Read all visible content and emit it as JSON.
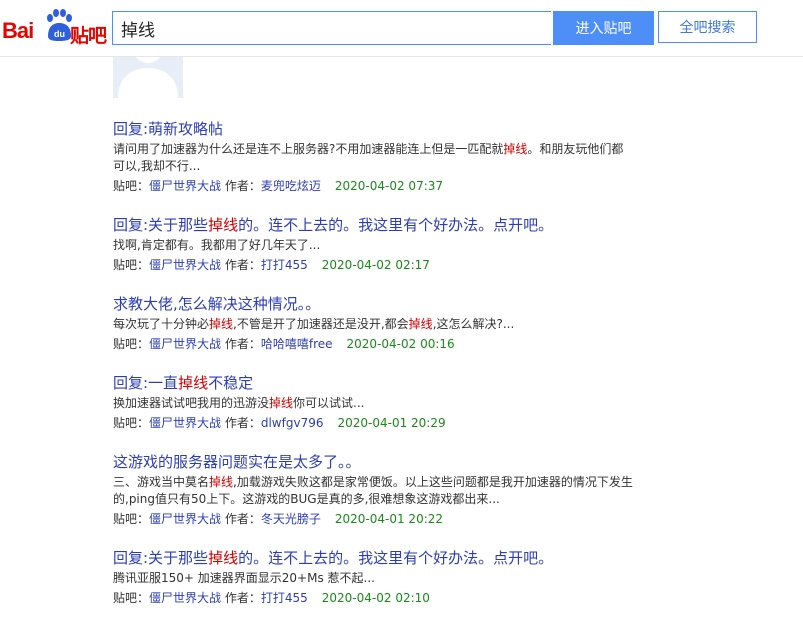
{
  "header": {
    "logo_text": "Bai",
    "logo_du": "du",
    "logo_tieba": "贴吧",
    "search_value": "掉线",
    "enter_button": "进入贴吧",
    "all_search_button": "全吧搜索"
  },
  "colors": {
    "accent": "#4e8ef7",
    "link": "#2d3eb5",
    "highlight": "#d00000",
    "date": "#1a8a1a"
  },
  "meta_labels": {
    "forum_prefix": "贴吧：",
    "author_prefix": " 作者："
  },
  "keyword": "掉线",
  "posts": [
    {
      "title": "回复:萌新攻略帖",
      "snippet": "请问用了加速器为什么还是连不上服务器?不用加速器能连上但是一匹配就掉线。和朋友玩他们都可以,我却不行...",
      "forum": "僵尸世界大战",
      "author": "麦兜吃炫迈",
      "date": "2020-04-02 07:37"
    },
    {
      "title": "回复:关于那些掉线的。连不上去的。我这里有个好办法。点开吧。",
      "snippet": "找啊,肯定都有。我都用了好几年天了...",
      "forum": "僵尸世界大战",
      "author": "打打455",
      "date": "2020-04-02 02:17"
    },
    {
      "title": "求教大佬,怎么解决这种情况。。",
      "snippet": "每次玩了十分钟必掉线,不管是开了加速器还是没开,都会掉线,这怎么解决?...",
      "forum": "僵尸世界大战",
      "author": "哈哈嘻嘻free",
      "date": "2020-04-02 00:16"
    },
    {
      "title": "回复:一直掉线不稳定",
      "snippet": "换加速器试试吧我用的迅游没掉线你可以试试...",
      "forum": "僵尸世界大战",
      "author": "dlwfgv796",
      "date": "2020-04-01 20:29"
    },
    {
      "title": "这游戏的服务器问题实在是太多了。。",
      "snippet": "三、游戏当中莫名掉线,加载游戏失败这都是家常便饭。以上这些问题都是我开加速器的情况下发生的,ping值只有50上下。这游戏的BUG是真的多,很难想象这游戏都出来...",
      "forum": "僵尸世界大战",
      "author": "冬天光膀子",
      "date": "2020-04-01 20:22"
    },
    {
      "title": "回复:关于那些掉线的。连不上去的。我这里有个好办法。点开吧。",
      "snippet": "腾讯亚服150+ 加速器界面显示20+Ms 惹不起...",
      "forum": "僵尸世界大战",
      "author": "打打455",
      "date": "2020-04-02 02:10"
    }
  ]
}
